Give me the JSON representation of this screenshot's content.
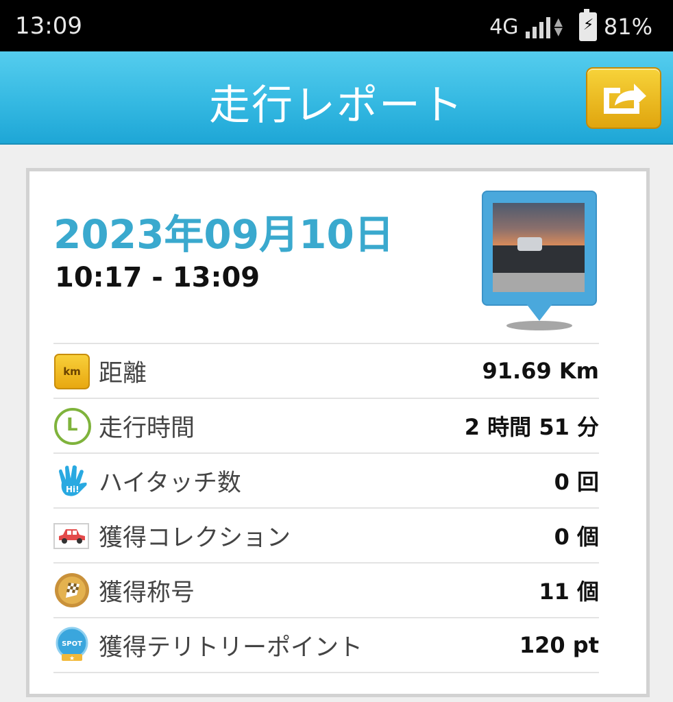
{
  "status_bar": {
    "time": "13:09",
    "network": "4G",
    "battery": "81%"
  },
  "header": {
    "title": "走行レポート",
    "share_icon": "share-icon"
  },
  "report": {
    "date": "2023年09月10日",
    "time_range": "10:17 - 13:09",
    "rows": [
      {
        "icon": "km-icon",
        "icon_text": "km",
        "label": "距離",
        "value": "91.69 Km"
      },
      {
        "icon": "clock-icon",
        "label": "走行時間",
        "value": "2 時間 51 分"
      },
      {
        "icon": "hand-icon",
        "label": "ハイタッチ数",
        "value": "0 回"
      },
      {
        "icon": "car-icon",
        "label": "獲得コレクション",
        "value": "0 個"
      },
      {
        "icon": "checkered-flag-medal-icon",
        "label": "獲得称号",
        "value": "11 個"
      },
      {
        "icon": "spot-badge-icon",
        "icon_text": "SPOT",
        "label": "獲得テリトリーポイント",
        "value": "120 pt"
      }
    ]
  },
  "colors": {
    "header_blue": "#35b9e2",
    "date_blue": "#3aa9ce",
    "share_gold": "#f0be22"
  }
}
